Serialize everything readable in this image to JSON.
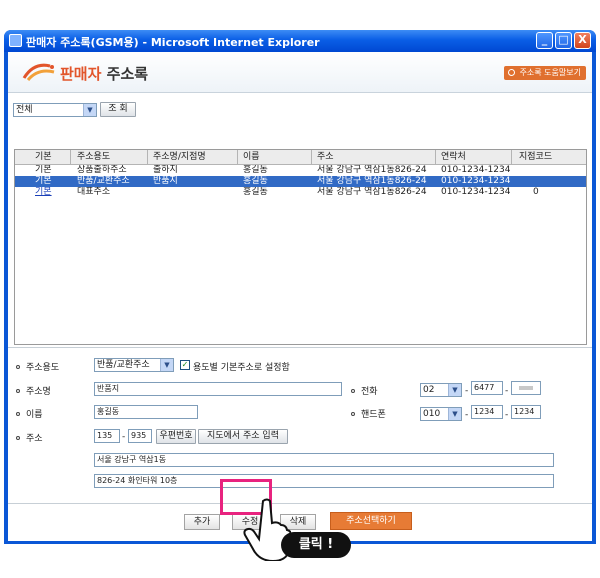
{
  "window": {
    "title": "판매자 주소록(GSM용) - Microsoft Internet Explorer",
    "minimize": "_",
    "maximize": "□",
    "close": "X"
  },
  "header": {
    "title_accent": "판매자",
    "title_rest": "주소록",
    "guide_button": "주소록 도움말보기"
  },
  "filter": {
    "selected": "전체",
    "search_button": "조 회"
  },
  "list": {
    "columns": [
      "기본",
      "주소용도",
      "주소명/지점명",
      "이름",
      "주소",
      "연락처",
      "지점코드"
    ],
    "rows": [
      {
        "default": "기본",
        "purpose": "상품출하주소",
        "name": "출하지",
        "person": "홍길동",
        "address": "서울 강남구 역삼1동826-24",
        "phone": "010-1234-1234",
        "code": ""
      },
      {
        "default": "기본",
        "purpose": "반품/교환주소",
        "name": "반품지",
        "person": "홍길동",
        "address": "서울 강남구 역삼1동826-24",
        "phone": "010-1234-1234",
        "code": ""
      },
      {
        "default": "기본",
        "purpose": "대표주소",
        "name": "",
        "person": "홍길동",
        "address": "서울 강남구 역삼1동826-24",
        "phone": "010-1234-1234",
        "code": "0"
      }
    ]
  },
  "form": {
    "purpose_label": "주소용도",
    "purpose_value": "반품/교환주소",
    "default_checkbox_label": "용도별 기본주소로 설정함",
    "default_checked": "✓",
    "name_label": "주소명",
    "name_value": "반품지",
    "person_label": "이름",
    "person_value": "홍길동",
    "address_label": "주소",
    "zip1": "135",
    "zip2": "935",
    "zip_button": "우편번호",
    "map_button": "지도에서 주소 입력",
    "address1": "서울 강남구 역삼1동",
    "address2": "826-24  화인타워 10층",
    "phone_label": "전화",
    "phone_area": "02",
    "phone_mid": "6477",
    "mobile_label": "핸드폰",
    "mobile_prefix": "010",
    "mobile_mid": "1234",
    "mobile_last": "1234"
  },
  "actions": {
    "add": "추가",
    "edit": "수정",
    "delete": "삭제",
    "select_address": "주소선택하기"
  },
  "callout": "클릭 !"
}
